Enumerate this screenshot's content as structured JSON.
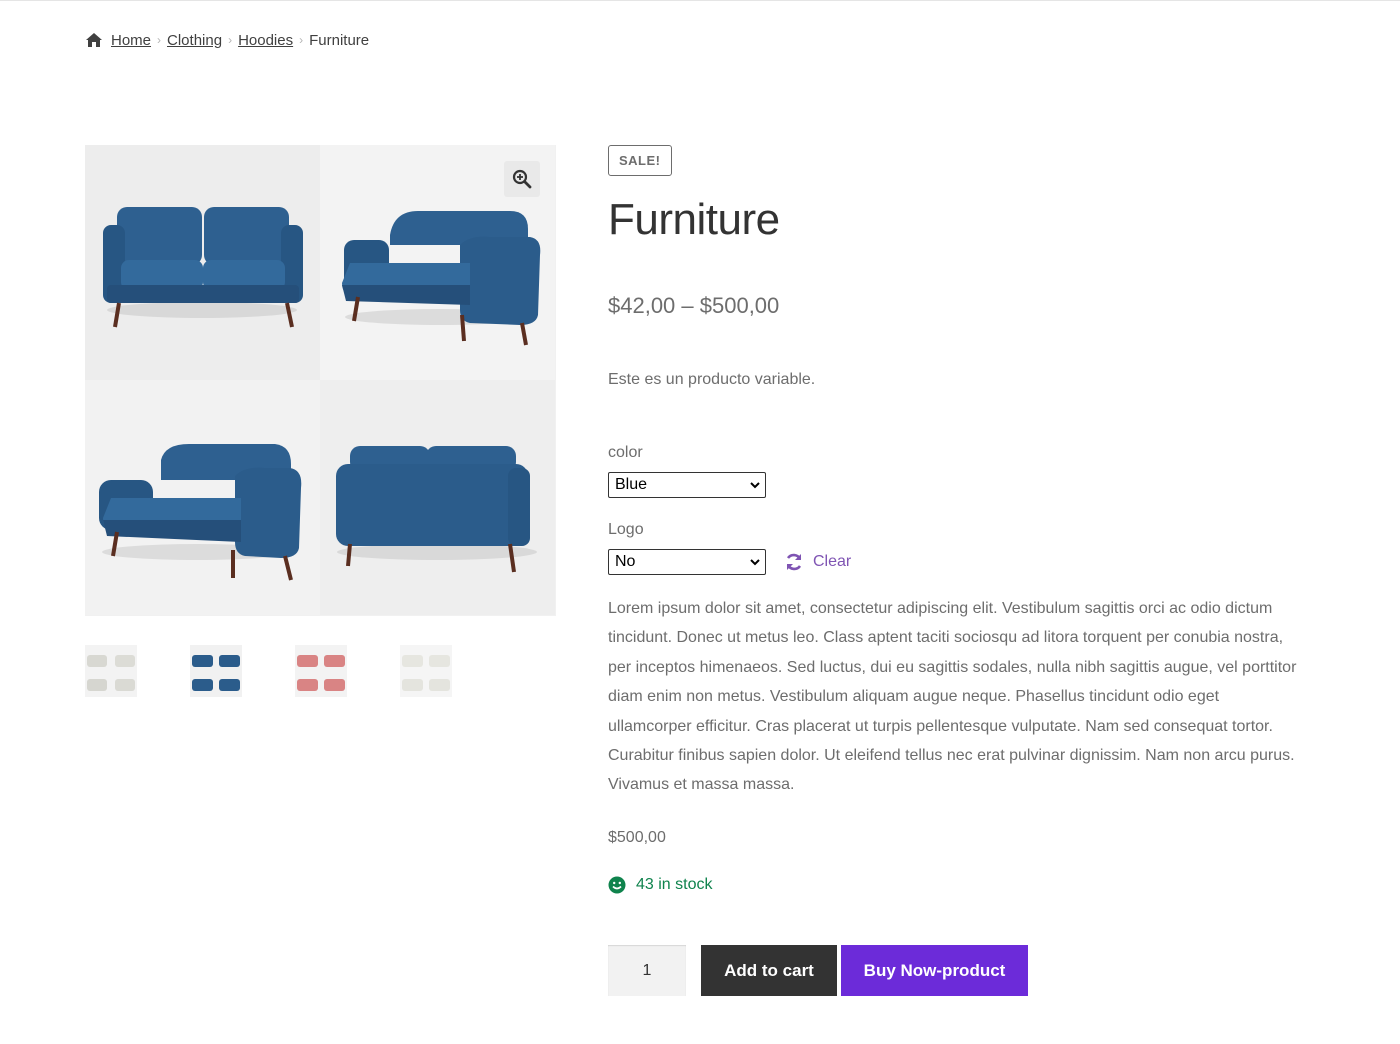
{
  "breadcrumb": {
    "home": "Home",
    "items": [
      "Clothing",
      "Hoodies"
    ],
    "current": "Furniture"
  },
  "gallery": {
    "zoom_icon": "magnifier-plus-icon",
    "thumbnails": [
      "white-sofa-thumb",
      "blue-sofa-thumb",
      "pink-sofa-thumb",
      "cream-sofa-thumb"
    ]
  },
  "product": {
    "badge": "SALE!",
    "title": "Furniture",
    "price_range": "$42,00 – $500,00",
    "short_description": "Este es un producto variable.",
    "variations": {
      "color_label": "color",
      "color_value": "Blue",
      "logo_label": "Logo",
      "logo_value": "No",
      "clear_label": "Clear"
    },
    "description": "Lorem ipsum dolor sit amet, consectetur adipiscing elit. Vestibulum sagittis orci ac odio dictum tincidunt. Donec ut metus leo. Class aptent taciti sociosqu ad litora torquent per conubia nostra, per inceptos himenaeos. Sed luctus, dui eu sagittis sodales, nulla nibh sagittis augue, vel porttitor diam enim non metus. Vestibulum aliquam augue neque. Phasellus tincidunt odio eget ullamcorper efficitur. Cras placerat ut turpis pellentesque vulputate. Nam sed consequat tortor. Curabitur finibus sapien dolor. Ut eleifend tellus nec erat pulvinar dignissim. Nam non arcu purus. Vivamus et massa massa.",
    "variation_price": "$500,00",
    "stock": "43 in stock",
    "quantity": "1",
    "add_to_cart": "Add to cart",
    "buy_now": "Buy Now-product"
  },
  "colors": {
    "sofa_blue": "#2d5f8e",
    "accent_purple": "#7f54b3",
    "buy_button": "#6c2bd9",
    "cart_button": "#333333",
    "stock_green": "#0f834d"
  }
}
